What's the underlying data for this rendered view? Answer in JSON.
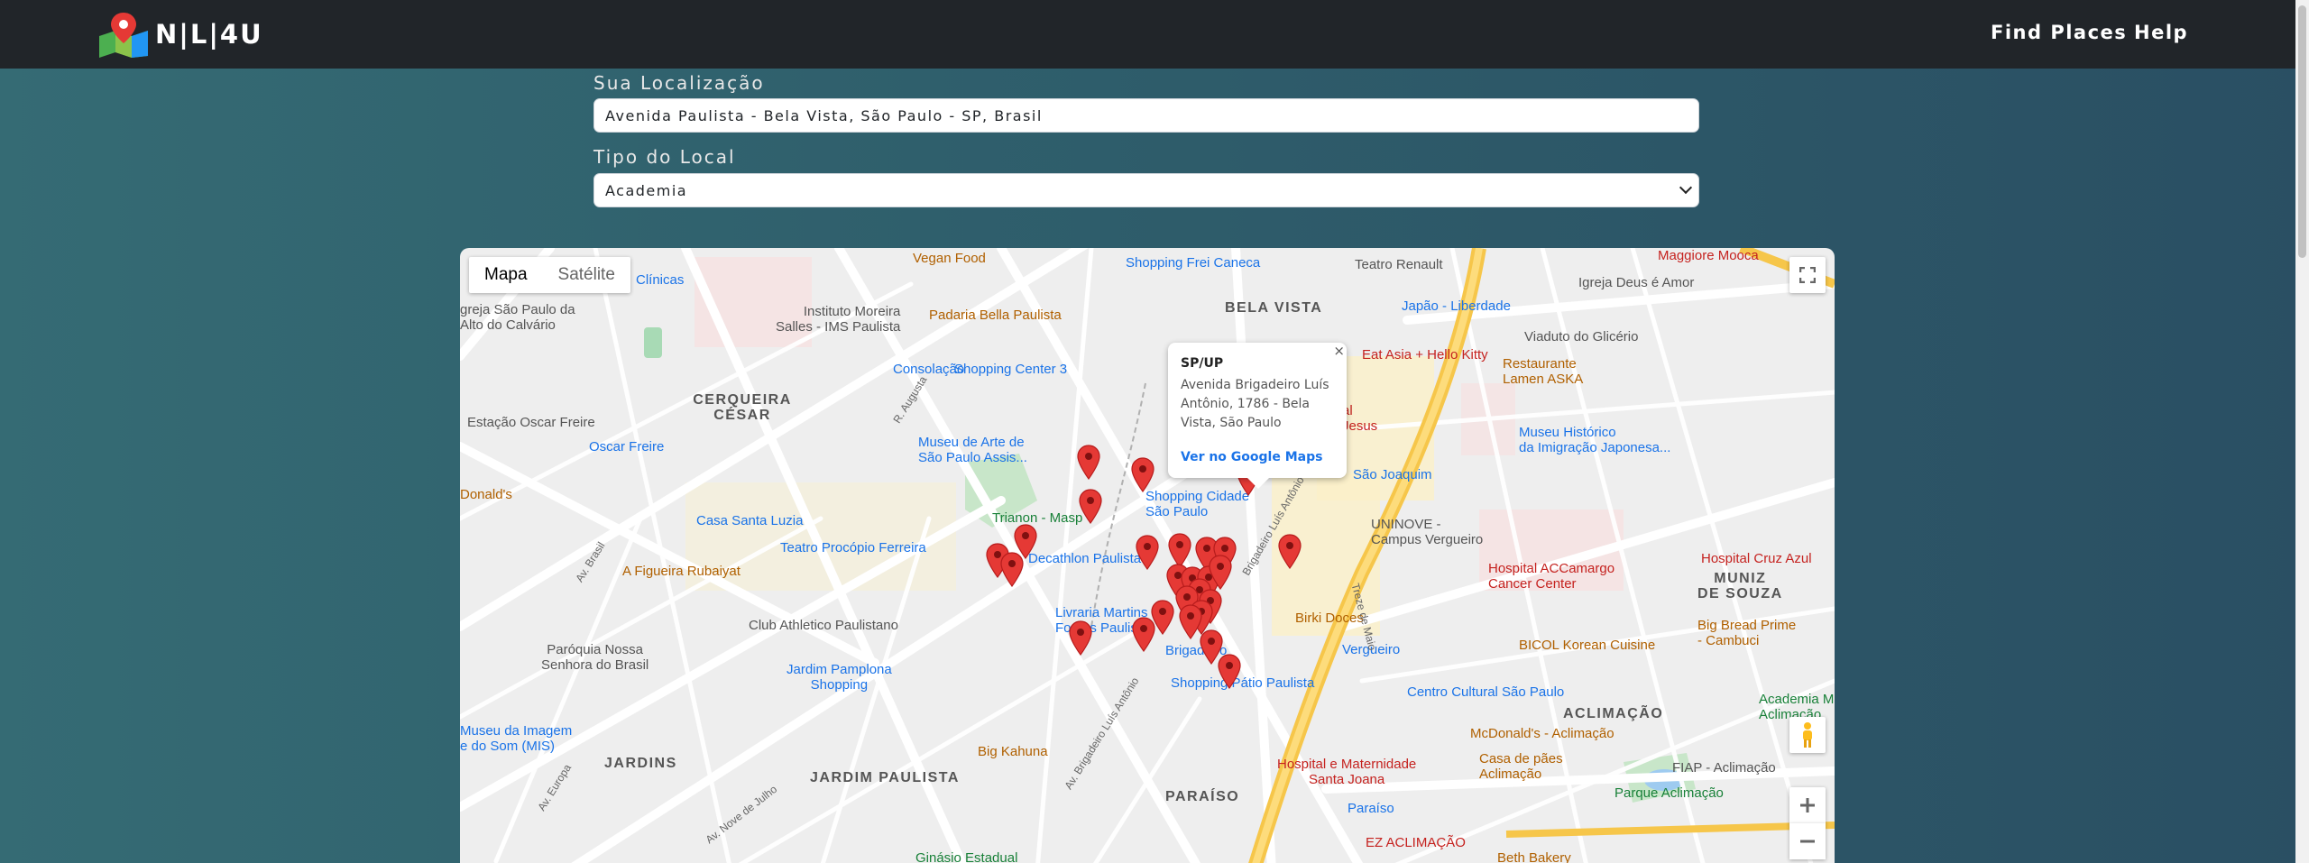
{
  "navbar": {
    "brand": "N|L|4U",
    "links": [
      "Find Places",
      "Help"
    ]
  },
  "form": {
    "location_label": "Sua Localização",
    "location_value": "Avenida Paulista - Bela Vista, São Paulo - SP, Brasil",
    "type_label": "Tipo do Local",
    "type_value": "Academia"
  },
  "map": {
    "map_type_buttons": [
      "Mapa",
      "Satélite"
    ],
    "active_map_type": "Mapa",
    "controls": [
      "fullscreen-icon",
      "pegman-icon",
      "zoom-in-icon",
      "zoom-out-icon"
    ],
    "labels": {
      "bela_vista": "BELA VISTA",
      "cerqueira_cesar": "CERQUEIRA\nCÉSAR",
      "jardins": "JARDINS",
      "jardim_paulista": "JARDIM PAULISTA",
      "paraiso": "PARAÍSO",
      "aclimacao": "ACLIMAÇÃO",
      "liberdade": "Japão - Liberdade",
      "uninove": "UNINOVE -\nCampus Vergueiro",
      "muniz": "MUNIZ\nDE SOUZA",
      "shopping_frei_caneca": "Shopping Frei Caneca",
      "teatro_renault": "Teatro Renault",
      "maggiore": "Maggiore Mooca",
      "vegan_food": "Vegan Food",
      "instituto_moreira": "Instituto Moreira\nSalles - IMS Paulista",
      "padaria": "Padaria Bella Paulista",
      "consolacao": "Consolação",
      "shopping_center_3": "Shopping Center 3",
      "masp": "Museu de Arte de\nSão Paulo Assis...",
      "shopping_cidade": "Shopping Cidade\nSão Paulo",
      "trianon": "Trianon - Masp",
      "casa_santa_luzia": "Casa Santa Luzia",
      "teatro_procopio": "Teatro Procópio Ferreira",
      "a_figueira": "A Figueira Rubaiyat",
      "decathlon": "Decathlon Paulista",
      "livraria_martins": "Livraria Martins\nFontes Paulista",
      "club_athletico": "Club Athletico Paulistano",
      "paroquia": "Paróquia Nossa\nSenhora do Brasil",
      "jardim_pamplona": "Jardim Pamplona\nShopping",
      "museu_imagem": "Museu da Imagem\ne do Som (MIS)",
      "big_kahuna": "Big Kahuna",
      "brigadeiro": "Brigadeiro",
      "shopping_patio": "Shopping Pátio Paulista",
      "estacao_oscar": "Estação Oscar Freire",
      "oscar_freire": "Oscar Freire",
      "mcdonalds_left": "Donald's",
      "clinicas": "Clínicas",
      "igreja_sp": "greja São Paulo da\nAlto do Calvário",
      "eat_asia": "Eat Asia + Hello Kitty",
      "restaurante_aska": "Restaurante\nLamen ASKA",
      "museu_historico": "Museu Histórico\nda Imigração Japonesa...",
      "igreja_deus": "Igreja Deus é Amor",
      "viaduto": "Viaduto do Glicério",
      "sao_joaquim": "São Joaquim",
      "hospital_accamargo": "Hospital ACCamargo\nCancer Center",
      "hospital_cruz_azul": "Hospital Cruz Azul",
      "birki_doces": "Birki Doces",
      "vergueiro": "Vergueiro",
      "bicol": "BICOL Korean Cuisine",
      "big_bread": "Big Bread Prime\n- Cambuci",
      "centro_cultural": "Centro Cultural São Paulo",
      "academia_mv": "Academia M\nAclimação",
      "mcdonalds_aclimacao": "McDonald's - Aclimação",
      "casa_paes": "Casa de pães\nAclimação",
      "fiap": "FIAP - Aclimação",
      "parque_aclimacao": "Parque Aclimação",
      "hospital_maternidade": "Hospital e Maternidade\nSanta Joana",
      "paraiso_metro": "Paraíso",
      "ez_aclimacao": "EZ ACLIMAÇÃO",
      "beth_bakery": "Beth Bakery",
      "ginasio": "Ginásio Estadual",
      "jesus": "al\nJesus",
      "av_paulista_street": "Av. Brasil",
      "av_brigadeiro": "Av. Brigadeiro Luís Antônio",
      "treze_maio": "Treze de Maio",
      "augusta": "R. Augusta",
      "av_nove_julho": "Av. Nove de Julho",
      "av_europa": "Av. Europa",
      "brigadeiro_luis": "Brigadeiro Luís Antônio"
    },
    "popup": {
      "title": "SP/UP",
      "address": "Avenida Brigadeiro Luís Antônio, 1786 - Bela Vista, São Paulo",
      "link": "Ver no Google Maps",
      "close": "×"
    },
    "marker_color": "#e53935",
    "marker_count": 26
  }
}
